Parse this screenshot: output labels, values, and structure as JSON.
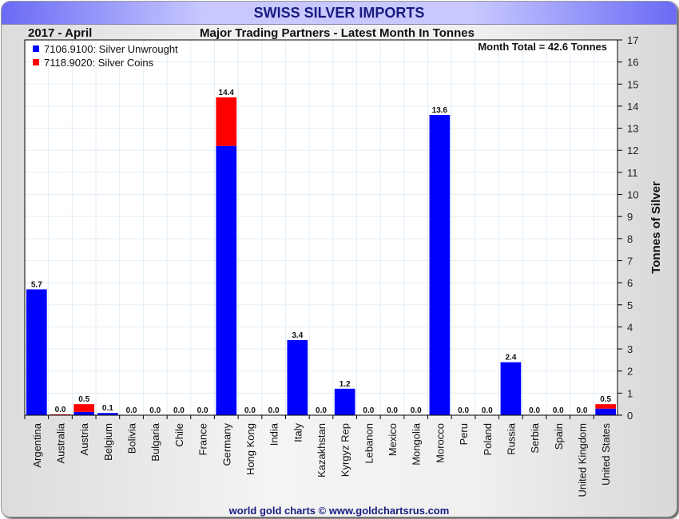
{
  "header": {
    "title": "SWISS SILVER IMPORTS",
    "period": "2017 - April",
    "subtitle": "Major Trading Partners - Latest Month In Tonnes"
  },
  "footer": "world gold charts © www.goldchartsrus.com",
  "chart_data": {
    "type": "bar",
    "stacked": true,
    "title": "SWISS SILVER IMPORTS",
    "annotation": "Month Total = 42.6 Tonnes",
    "ylabel": "Tonnes of Silver",
    "ylim": [
      0,
      17
    ],
    "yticks": [
      0,
      1,
      2,
      3,
      4,
      5,
      6,
      7,
      8,
      9,
      10,
      11,
      12,
      13,
      14,
      15,
      16,
      17
    ],
    "grid": true,
    "legend_position": "top-left",
    "categories": [
      "Argentina",
      "Australia",
      "Austria",
      "Belgium",
      "Bolivia",
      "Bulgaria",
      "Chile",
      "France",
      "Germany",
      "Hong Kong",
      "India",
      "Italy",
      "Kazakhstan",
      "Kyrgyz Rep",
      "Lebanon",
      "Mexico",
      "Mongolia",
      "Morocco",
      "Peru",
      "Poland",
      "Russia",
      "Serbia",
      "Spain",
      "United Kingdom",
      "United States"
    ],
    "series": [
      {
        "name": "7106.9100: Silver Unwrought",
        "color": "#0000ff",
        "values": [
          5.7,
          0,
          0.15,
          0.1,
          0,
          0,
          0,
          0,
          12.2,
          0,
          0,
          3.4,
          0,
          1.2,
          0,
          0,
          0,
          13.6,
          0,
          0,
          2.4,
          0,
          0,
          0,
          0.3
        ]
      },
      {
        "name": "7118.9020: Silver Coins",
        "color": "#ff0000",
        "values": [
          0,
          0.04,
          0.35,
          0,
          0,
          0,
          0,
          0,
          2.2,
          0,
          0,
          0,
          0,
          0,
          0,
          0,
          0,
          0,
          0,
          0,
          0,
          0,
          0,
          0,
          0.2
        ]
      }
    ],
    "labels": [
      "5.7",
      "0.0",
      "0.5",
      "0.1",
      "0.0",
      "0.0",
      "0.0",
      "0.0",
      "14.4",
      "0.0",
      "0.0",
      "3.4",
      "0.0",
      "1.2",
      "0.0",
      "0.0",
      "0.0",
      "13.6",
      "0.0",
      "0.0",
      "2.4",
      "0.0",
      "0.0",
      "0.0",
      "0.5"
    ]
  }
}
